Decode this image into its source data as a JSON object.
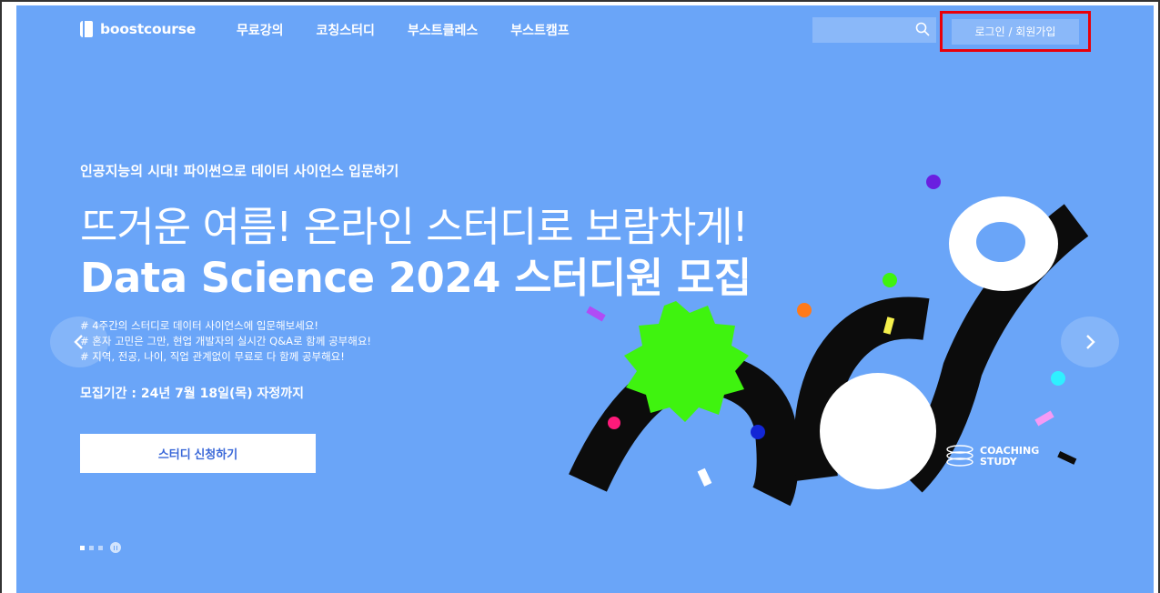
{
  "brand": {
    "logo_text": "boostcourse"
  },
  "nav": {
    "items": [
      {
        "label": "무료강의"
      },
      {
        "label": "코칭스터디"
      },
      {
        "label": "부스트클레스"
      },
      {
        "label": "부스트캠프"
      }
    ]
  },
  "header": {
    "login_label": "로그인 / 회원가입",
    "search_placeholder": ""
  },
  "hero": {
    "subtitle": "인공지능의 시대! 파이썬으로 데이터 사이언스 입문하기",
    "title_line1": "뜨거운 여름! 온라인 스터디로 보람차게!",
    "title_line2": "Data Science 2024 스터디원 모집",
    "bullets": [
      "# 4주간의 스터디로 데이터 사이언스에 입문해보세요!",
      "# 혼자 고민은 그만, 현업 개발자의 실시간 Q&A로 함께 공부해요!",
      "# 지역, 전공, 나이, 직업 관계없이 무료로 다 함께 공부해요!"
    ],
    "period": "모집기간 : 24년 7월 18일(목) 자정까지",
    "apply_label": "스터디 신청하기",
    "badge_line1": "COACHING",
    "badge_line2": "STUDY"
  },
  "carousel": {
    "slide_count": 3,
    "active_index": 0
  },
  "colors": {
    "background": "#6aa5f8",
    "accent_green": "#3ff30f",
    "highlight_border": "#e8000b"
  },
  "icons": [
    "logo-icon",
    "search-icon",
    "chevron-left-icon",
    "chevron-right-icon",
    "pause-icon",
    "coaching-study-icon"
  ]
}
